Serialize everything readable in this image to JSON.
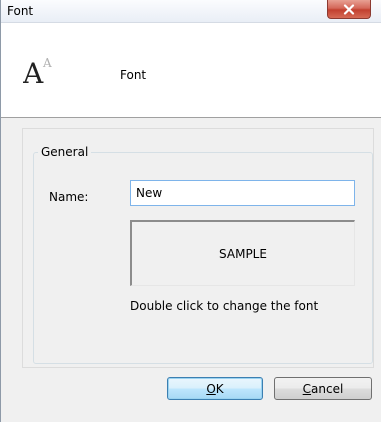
{
  "window": {
    "title": "Font"
  },
  "header": {
    "icon": "font-size-icon",
    "label": "Font"
  },
  "general_group": {
    "legend": "General",
    "name_label": "Name:",
    "name_value": "New",
    "sample_text": "SAMPLE",
    "hint": "Double click to change the font"
  },
  "buttons": {
    "ok_accel": "O",
    "ok_rest": "K",
    "cancel_accel": "C",
    "cancel_rest": "ancel"
  },
  "colors": {
    "close_button": "#c7402f",
    "focus_border": "#7eb4ea"
  }
}
